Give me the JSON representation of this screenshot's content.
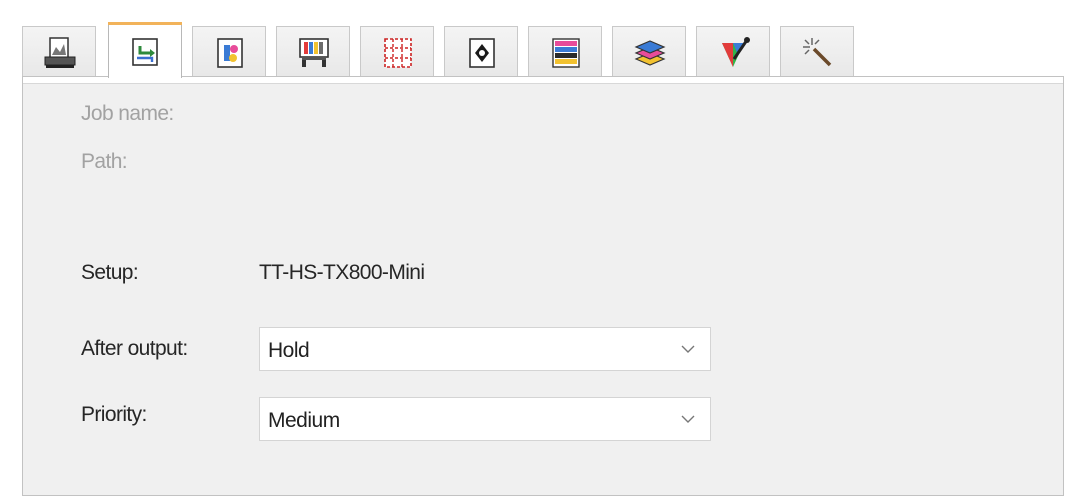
{
  "tabs": [
    {
      "icon": "printer-icon",
      "active": false
    },
    {
      "icon": "job-output-icon",
      "active": true
    },
    {
      "icon": "document-color-icon",
      "active": false
    },
    {
      "icon": "large-format-printer-icon",
      "active": false
    },
    {
      "icon": "tile-layout-icon",
      "active": false
    },
    {
      "icon": "page-register-icon",
      "active": false
    },
    {
      "icon": "color-strips-icon",
      "active": false
    },
    {
      "icon": "layers-icon",
      "active": false
    },
    {
      "icon": "color-picker-icon",
      "active": false
    },
    {
      "icon": "magic-wand-icon",
      "active": false
    }
  ],
  "job": {
    "job_name_label": "Job name:",
    "path_label": "Path:"
  },
  "setup": {
    "label": "Setup:",
    "value": "TT-HS-TX800-Mini"
  },
  "after_output": {
    "label": "After output:",
    "value": "Hold"
  },
  "priority": {
    "label": "Priority:",
    "value": "Medium"
  },
  "colors": {
    "active_tab_accent": "#f2b35a",
    "panel_background": "#f0f0f0",
    "disabled_text": "#a2a2a2"
  }
}
